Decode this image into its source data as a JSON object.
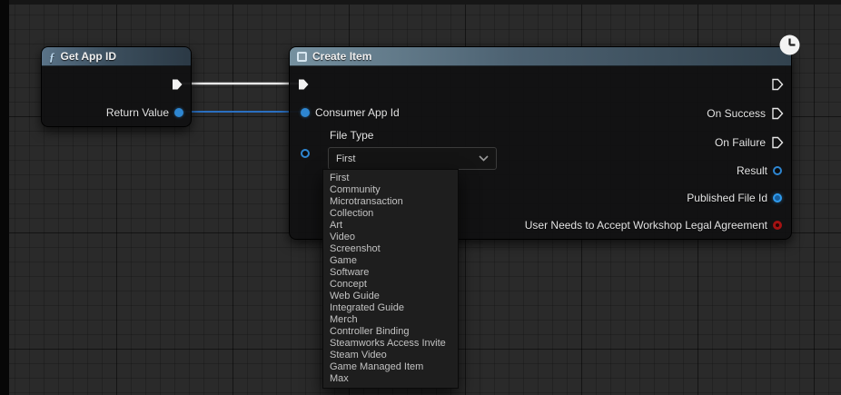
{
  "nodes": {
    "get_app_id": {
      "title": "Get App ID",
      "outputs": {
        "return_value": "Return Value"
      }
    },
    "create_item": {
      "title": "Create Item",
      "inputs": {
        "consumer_app_id": "Consumer App Id",
        "file_type": "File Type"
      },
      "outputs": {
        "on_success": "On Success",
        "on_failure": "On Failure",
        "result": "Result",
        "published_file_id": "Published File Id",
        "legal_agreement": "User Needs to Accept Workshop Legal Agreement"
      }
    }
  },
  "file_type_dropdown": {
    "selected": "First",
    "options": [
      "First",
      "Community",
      "Microtransaction",
      "Collection",
      "Art",
      "Video",
      "Screenshot",
      "Game",
      "Software",
      "Concept",
      "Web Guide",
      "Integrated Guide",
      "Merch",
      "Controller Binding",
      "Steamworks Access Invite",
      "Steam Video",
      "Game Managed Item",
      "Max"
    ]
  },
  "colors": {
    "exec_wire": "#e8e8e8",
    "data_wire": "#2a6fc0",
    "pin_blue": "#2e86d1",
    "pin_red": "#a51212"
  }
}
